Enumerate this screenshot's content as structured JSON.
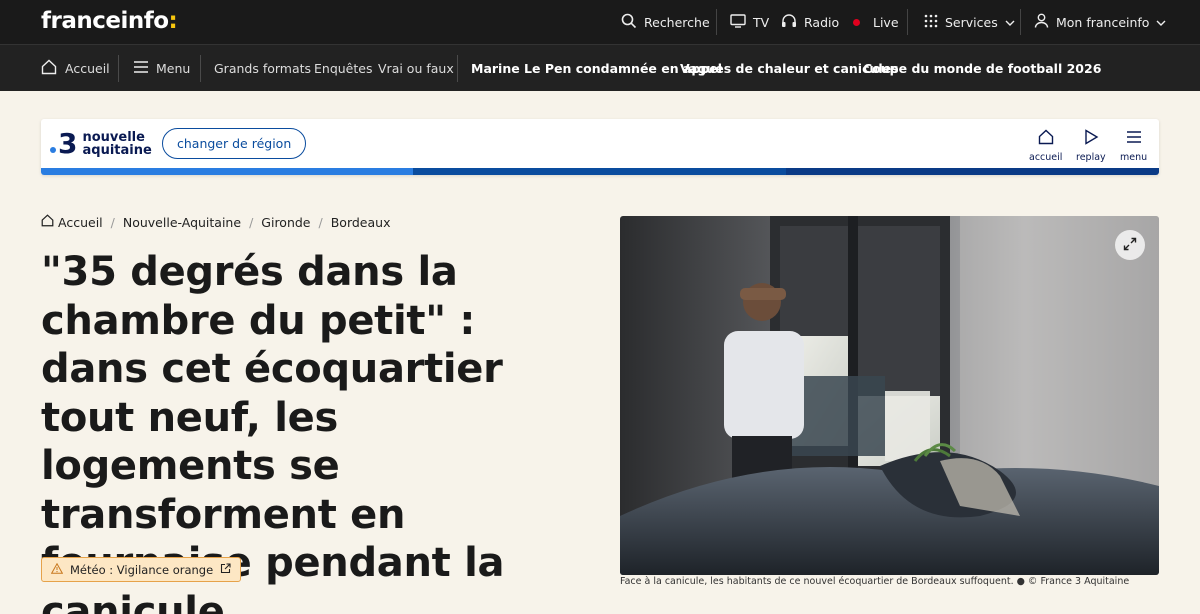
{
  "topbar": {
    "logo": "franceinfo",
    "logo_colon": ":",
    "search": "Recherche",
    "tv": "TV",
    "radio": "Radio",
    "live": "Live",
    "services": "Services",
    "account": "Mon franceinfo"
  },
  "nav": {
    "home": "Accueil",
    "menu": "Menu",
    "links": [
      "Grands formats",
      "Enquêtes",
      "Vrai ou faux"
    ],
    "topics": [
      "Marine Le Pen condamnée en appel",
      "Vagues de chaleur et canicules",
      "Coupe du monde de football 2026"
    ]
  },
  "region": {
    "number": "3",
    "name_line1": "nouvelle",
    "name_line2": "aquitaine",
    "change_button": "changer de région",
    "home_label": "accueil",
    "replay_label": "replay",
    "menu_label": "menu",
    "stripe_colors": [
      "#2a7de1",
      "#0a4c9e",
      "#0a3a86"
    ]
  },
  "breadcrumb": [
    "Accueil",
    "Nouvelle-Aquitaine",
    "Gironde",
    "Bordeaux"
  ],
  "article": {
    "headline": "\"35 degrés dans la chambre du petit\" : dans cet écoquartier tout neuf, les logements se transforment en fournaise pendant la canicule",
    "weather_tag": "Météo : Vigilance orange",
    "caption": "Face à la canicule, les habitants de ce nouvel écoquartier de Bordeaux suffoquent. ● © France 3 Aquitaine"
  },
  "colors": {
    "topbar_bg": "#1a1a1a",
    "navbar_bg": "#222222",
    "page_bg": "#f7f3ea",
    "accent_yellow": "#f7c60e",
    "live_red": "#e1001e",
    "region_blue": "#0a4c9e"
  }
}
